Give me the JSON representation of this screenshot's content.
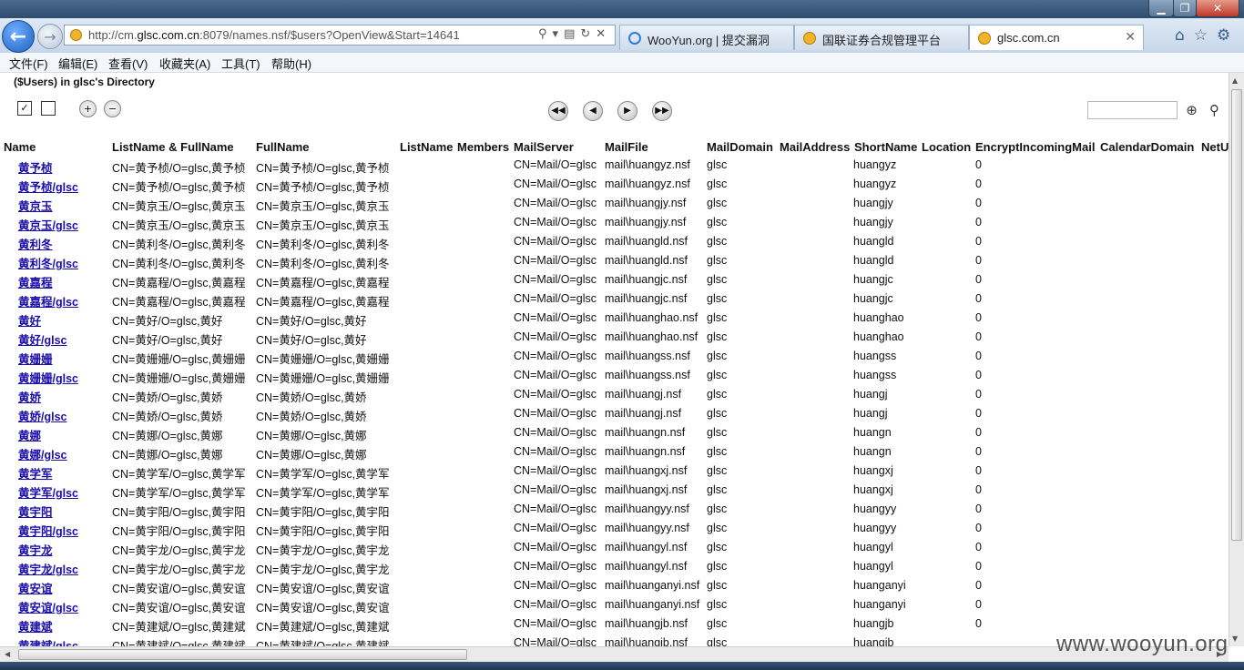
{
  "browser": {
    "url_prefix": "http://cm.",
    "url_domain": "glsc.com.cn",
    "url_suffix": ":8079/names.nsf/$users?OpenView&Start=14641",
    "tabs": [
      {
        "label": "WooYun.org | 提交漏洞"
      },
      {
        "label": "国联证券合规管理平台"
      },
      {
        "label": "glsc.com.cn"
      }
    ]
  },
  "menu": [
    "文件(F)",
    "编辑(E)",
    "查看(V)",
    "收藏夹(A)",
    "工具(T)",
    "帮助(H)"
  ],
  "view": {
    "title": "($Users) in glsc's Directory",
    "columns": [
      "Name",
      "ListName & FullName",
      "FullName",
      "ListName",
      "Members",
      "MailServer",
      "MailFile",
      "MailDomain",
      "MailAddress",
      "ShortName",
      "Location",
      "EncryptIncomingMail",
      "CalendarDomain",
      "NetU"
    ]
  },
  "rows": [
    {
      "name": "黄予桢",
      "listname": "CN=黄予桢/O=glsc,黄予桢",
      "fullname": "CN=黄予桢/O=glsc,黄予桢",
      "server": "CN=Mail/O=glsc",
      "mailfile": "mail\\huangyz.nsf",
      "domain": "glsc",
      "short": "huangyz",
      "encrypt": "0"
    },
    {
      "name": "黄予桢/glsc",
      "listname": "CN=黄予桢/O=glsc,黄予桢",
      "fullname": "CN=黄予桢/O=glsc,黄予桢",
      "server": "CN=Mail/O=glsc",
      "mailfile": "mail\\huangyz.nsf",
      "domain": "glsc",
      "short": "huangyz",
      "encrypt": "0"
    },
    {
      "name": "黄京玉",
      "listname": "CN=黄京玉/O=glsc,黄京玉",
      "fullname": "CN=黄京玉/O=glsc,黄京玉",
      "server": "CN=Mail/O=glsc",
      "mailfile": "mail\\huangjy.nsf",
      "domain": "glsc",
      "short": "huangjy",
      "encrypt": "0"
    },
    {
      "name": "黄京玉/glsc",
      "listname": "CN=黄京玉/O=glsc,黄京玉",
      "fullname": "CN=黄京玉/O=glsc,黄京玉",
      "server": "CN=Mail/O=glsc",
      "mailfile": "mail\\huangjy.nsf",
      "domain": "glsc",
      "short": "huangjy",
      "encrypt": "0"
    },
    {
      "name": "黄利冬",
      "listname": "CN=黄利冬/O=glsc,黄利冬",
      "fullname": "CN=黄利冬/O=glsc,黄利冬",
      "server": "CN=Mail/O=glsc",
      "mailfile": "mail\\huangld.nsf",
      "domain": "glsc",
      "short": "huangld",
      "encrypt": "0"
    },
    {
      "name": "黄利冬/glsc",
      "listname": "CN=黄利冬/O=glsc,黄利冬",
      "fullname": "CN=黄利冬/O=glsc,黄利冬",
      "server": "CN=Mail/O=glsc",
      "mailfile": "mail\\huangld.nsf",
      "domain": "glsc",
      "short": "huangld",
      "encrypt": "0"
    },
    {
      "name": "黄嘉程",
      "listname": "CN=黄嘉程/O=glsc,黄嘉程",
      "fullname": "CN=黄嘉程/O=glsc,黄嘉程",
      "server": "CN=Mail/O=glsc",
      "mailfile": "mail\\huangjc.nsf",
      "domain": "glsc",
      "short": "huangjc",
      "encrypt": "0"
    },
    {
      "name": "黄嘉程/glsc",
      "listname": "CN=黄嘉程/O=glsc,黄嘉程",
      "fullname": "CN=黄嘉程/O=glsc,黄嘉程",
      "server": "CN=Mail/O=glsc",
      "mailfile": "mail\\huangjc.nsf",
      "domain": "glsc",
      "short": "huangjc",
      "encrypt": "0"
    },
    {
      "name": "黄好",
      "listname": "CN=黄好/O=glsc,黄好",
      "fullname": "CN=黄好/O=glsc,黄好",
      "server": "CN=Mail/O=glsc",
      "mailfile": "mail\\huanghao.nsf",
      "domain": "glsc",
      "short": "huanghao",
      "encrypt": "0"
    },
    {
      "name": "黄好/glsc",
      "listname": "CN=黄好/O=glsc,黄好",
      "fullname": "CN=黄好/O=glsc,黄好",
      "server": "CN=Mail/O=glsc",
      "mailfile": "mail\\huanghao.nsf",
      "domain": "glsc",
      "short": "huanghao",
      "encrypt": "0"
    },
    {
      "name": "黄姗姗",
      "listname": "CN=黄姗姗/O=glsc,黄姗姗",
      "fullname": "CN=黄姗姗/O=glsc,黄姗姗",
      "server": "CN=Mail/O=glsc",
      "mailfile": "mail\\huangss.nsf",
      "domain": "glsc",
      "short": "huangss",
      "encrypt": "0"
    },
    {
      "name": "黄姗姗/glsc",
      "listname": "CN=黄姗姗/O=glsc,黄姗姗",
      "fullname": "CN=黄姗姗/O=glsc,黄姗姗",
      "server": "CN=Mail/O=glsc",
      "mailfile": "mail\\huangss.nsf",
      "domain": "glsc",
      "short": "huangss",
      "encrypt": "0"
    },
    {
      "name": "黄娇",
      "listname": "CN=黄娇/O=glsc,黄娇",
      "fullname": "CN=黄娇/O=glsc,黄娇",
      "server": "CN=Mail/O=glsc",
      "mailfile": "mail\\huangj.nsf",
      "domain": "glsc",
      "short": "huangj",
      "encrypt": "0"
    },
    {
      "name": "黄娇/glsc",
      "listname": "CN=黄娇/O=glsc,黄娇",
      "fullname": "CN=黄娇/O=glsc,黄娇",
      "server": "CN=Mail/O=glsc",
      "mailfile": "mail\\huangj.nsf",
      "domain": "glsc",
      "short": "huangj",
      "encrypt": "0"
    },
    {
      "name": "黄娜",
      "listname": "CN=黄娜/O=glsc,黄娜",
      "fullname": "CN=黄娜/O=glsc,黄娜",
      "server": "CN=Mail/O=glsc",
      "mailfile": "mail\\huangn.nsf",
      "domain": "glsc",
      "short": "huangn",
      "encrypt": "0"
    },
    {
      "name": "黄娜/glsc",
      "listname": "CN=黄娜/O=glsc,黄娜",
      "fullname": "CN=黄娜/O=glsc,黄娜",
      "server": "CN=Mail/O=glsc",
      "mailfile": "mail\\huangn.nsf",
      "domain": "glsc",
      "short": "huangn",
      "encrypt": "0"
    },
    {
      "name": "黄学军",
      "listname": "CN=黄学军/O=glsc,黄学军",
      "fullname": "CN=黄学军/O=glsc,黄学军",
      "server": "CN=Mail/O=glsc",
      "mailfile": "mail\\huangxj.nsf",
      "domain": "glsc",
      "short": "huangxj",
      "encrypt": "0"
    },
    {
      "name": "黄学军/glsc",
      "listname": "CN=黄学军/O=glsc,黄学军",
      "fullname": "CN=黄学军/O=glsc,黄学军",
      "server": "CN=Mail/O=glsc",
      "mailfile": "mail\\huangxj.nsf",
      "domain": "glsc",
      "short": "huangxj",
      "encrypt": "0"
    },
    {
      "name": "黄宇阳",
      "listname": "CN=黄宇阳/O=glsc,黄宇阳",
      "fullname": "CN=黄宇阳/O=glsc,黄宇阳",
      "server": "CN=Mail/O=glsc",
      "mailfile": "mail\\huangyy.nsf",
      "domain": "glsc",
      "short": "huangyy",
      "encrypt": "0"
    },
    {
      "name": "黄宇阳/glsc",
      "listname": "CN=黄宇阳/O=glsc,黄宇阳",
      "fullname": "CN=黄宇阳/O=glsc,黄宇阳",
      "server": "CN=Mail/O=glsc",
      "mailfile": "mail\\huangyy.nsf",
      "domain": "glsc",
      "short": "huangyy",
      "encrypt": "0"
    },
    {
      "name": "黄宇龙",
      "listname": "CN=黄宇龙/O=glsc,黄宇龙",
      "fullname": "CN=黄宇龙/O=glsc,黄宇龙",
      "server": "CN=Mail/O=glsc",
      "mailfile": "mail\\huangyl.nsf",
      "domain": "glsc",
      "short": "huangyl",
      "encrypt": "0"
    },
    {
      "name": "黄宇龙/glsc",
      "listname": "CN=黄宇龙/O=glsc,黄宇龙",
      "fullname": "CN=黄宇龙/O=glsc,黄宇龙",
      "server": "CN=Mail/O=glsc",
      "mailfile": "mail\\huangyl.nsf",
      "domain": "glsc",
      "short": "huangyl",
      "encrypt": "0"
    },
    {
      "name": "黄安谊",
      "listname": "CN=黄安谊/O=glsc,黄安谊",
      "fullname": "CN=黄安谊/O=glsc,黄安谊",
      "server": "CN=Mail/O=glsc",
      "mailfile": "mail\\huanganyi.nsf",
      "domain": "glsc",
      "short": "huanganyi",
      "encrypt": "0"
    },
    {
      "name": "黄安谊/glsc",
      "listname": "CN=黄安谊/O=glsc,黄安谊",
      "fullname": "CN=黄安谊/O=glsc,黄安谊",
      "server": "CN=Mail/O=glsc",
      "mailfile": "mail\\huanganyi.nsf",
      "domain": "glsc",
      "short": "huanganyi",
      "encrypt": "0"
    },
    {
      "name": "黄建斌",
      "listname": "CN=黄建斌/O=glsc,黄建斌",
      "fullname": "CN=黄建斌/O=glsc,黄建斌",
      "server": "CN=Mail/O=glsc",
      "mailfile": "mail\\huangjb.nsf",
      "domain": "glsc",
      "short": "huangjb",
      "encrypt": "0"
    },
    {
      "name": "黄建斌/glsc",
      "listname": "CN=黄建斌/O=glsc,黄建斌",
      "fullname": "CN=黄建斌/O=glsc,黄建斌",
      "server": "CN=Mail/O=glsc",
      "mailfile": "mail\\huangjb.nsf",
      "domain": "glsc",
      "short": "huangjb",
      "encrypt": ""
    }
  ],
  "watermark": "www.wooyun.org"
}
